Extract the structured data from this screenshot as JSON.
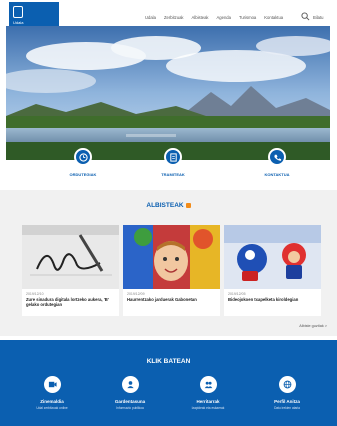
{
  "header": {
    "site_name": "Udala",
    "nav": [
      "Udala",
      "Zerbitzuak",
      "Albisteak",
      "Agenda",
      "Turismoa",
      "Kontaktua"
    ],
    "search_label": "Bilatu"
  },
  "quick_links": [
    {
      "label": "Ordutegiak",
      "icon": "clock-icon"
    },
    {
      "label": "Tramiteak",
      "icon": "document-icon"
    },
    {
      "label": "Kontaktua",
      "icon": "phone-icon"
    }
  ],
  "news": {
    "title": "ALBISTEAK",
    "items": [
      {
        "date": "2019/12/10",
        "headline": "Zure sinadura digitala lortzeko aukera, 'B' gelako ordutegian"
      },
      {
        "date": "2019/12/09",
        "headline": "Haurrentzako jarduerak Gabonetan"
      },
      {
        "date": "2019/12/05",
        "headline": "Bideojokoen txapelketa kiroldegian"
      }
    ],
    "more_label": "Albiste guztiak >"
  },
  "click_section": {
    "title": "KLIK BATEAN",
    "items": [
      {
        "title": "Zinemaldia",
        "sub": "Udal zerbitzuak online",
        "icon": "film-icon"
      },
      {
        "title": "Gardentasuna",
        "sub": "Informazio publikoa",
        "icon": "user-icon"
      },
      {
        "title": "Herritarrak",
        "sub": "Izapideak eta eskaerak",
        "icon": "people-icon"
      },
      {
        "title": "Perfil Anitza",
        "sub": "Datu irekien ataria",
        "icon": "globe-icon"
      }
    ]
  },
  "colors": {
    "brand_blue": "#0b5fb0",
    "news_bg": "#f1f1f1",
    "rss_orange": "#f28c1a"
  }
}
